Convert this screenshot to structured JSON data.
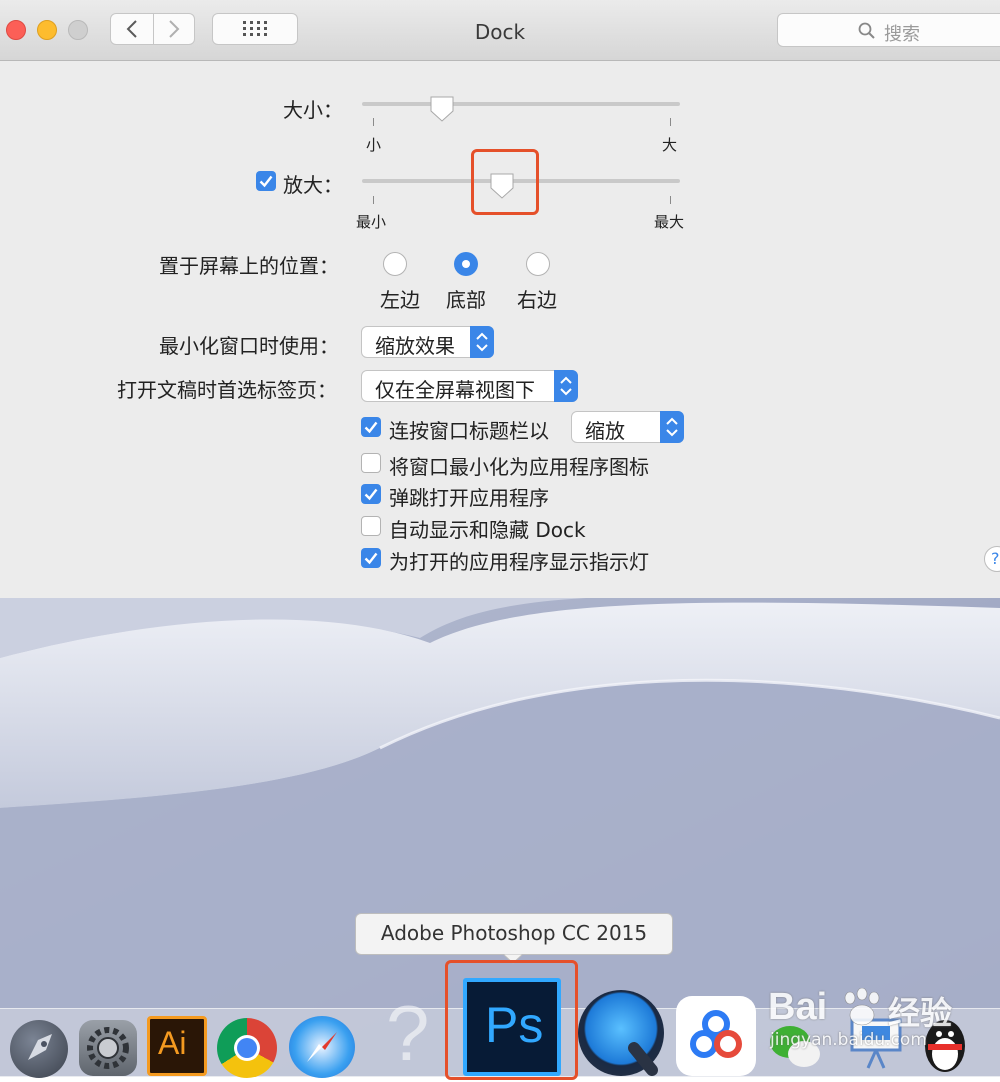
{
  "window": {
    "title": "Dock",
    "search_placeholder": "搜索",
    "help_label": "?"
  },
  "size": {
    "label": "大小：",
    "min_label": "小",
    "max_label": "大",
    "value": 0.25
  },
  "magnification": {
    "label": "放大：",
    "checked": true,
    "min_label": "最小",
    "max_label": "最大",
    "value": 0.44
  },
  "position": {
    "label": "置于屏幕上的位置：",
    "options": [
      {
        "label": "左边",
        "selected": false
      },
      {
        "label": "底部",
        "selected": true
      },
      {
        "label": "右边",
        "selected": false
      }
    ]
  },
  "minimize": {
    "label": "最小化窗口时使用：",
    "value": "缩放效果"
  },
  "tabs": {
    "label": "打开文稿时首选标签页：",
    "value": "仅在全屏幕视图下"
  },
  "checkboxes": [
    {
      "label": "连按窗口标题栏以",
      "checked": true,
      "popup": "缩放"
    },
    {
      "label": "将窗口最小化为应用程序图标",
      "checked": false
    },
    {
      "label": "弹跳打开应用程序",
      "checked": true
    },
    {
      "label": "自动显示和隐藏 Dock",
      "checked": false
    },
    {
      "label": "为打开的应用程序显示指示灯",
      "checked": true
    }
  ],
  "dock": {
    "tooltip": "Adobe Photoshop CC 2015",
    "apps": [
      {
        "name": "Launchpad",
        "icon": "rocket-icon"
      },
      {
        "name": "系统偏好设置",
        "icon": "gear-icon"
      },
      {
        "name": "Adobe Illustrator",
        "icon": "ai-icon",
        "text": "Ai"
      },
      {
        "name": "Google Chrome",
        "icon": "chrome-icon"
      },
      {
        "name": "Safari",
        "icon": "compass-icon"
      },
      {
        "name": "Unknown",
        "icon": "question-icon",
        "text": "?"
      },
      {
        "name": "Adobe Photoshop CC 2015",
        "icon": "ps-icon",
        "text": "Ps"
      },
      {
        "name": "QuickTime Player",
        "icon": "quicktime-icon"
      },
      {
        "name": "百度网盘",
        "icon": "cloud-icon"
      },
      {
        "name": "微信",
        "icon": "wechat-icon"
      },
      {
        "name": "Keynote",
        "icon": "keynote-icon"
      },
      {
        "name": "QQ",
        "icon": "penguin-icon"
      }
    ]
  },
  "watermark": {
    "brand": "Bai",
    "brand2": "经验",
    "url": "jingyan.baidu.com"
  },
  "colors": {
    "accent": "#3a86e8",
    "highlight": "#e5502a"
  }
}
